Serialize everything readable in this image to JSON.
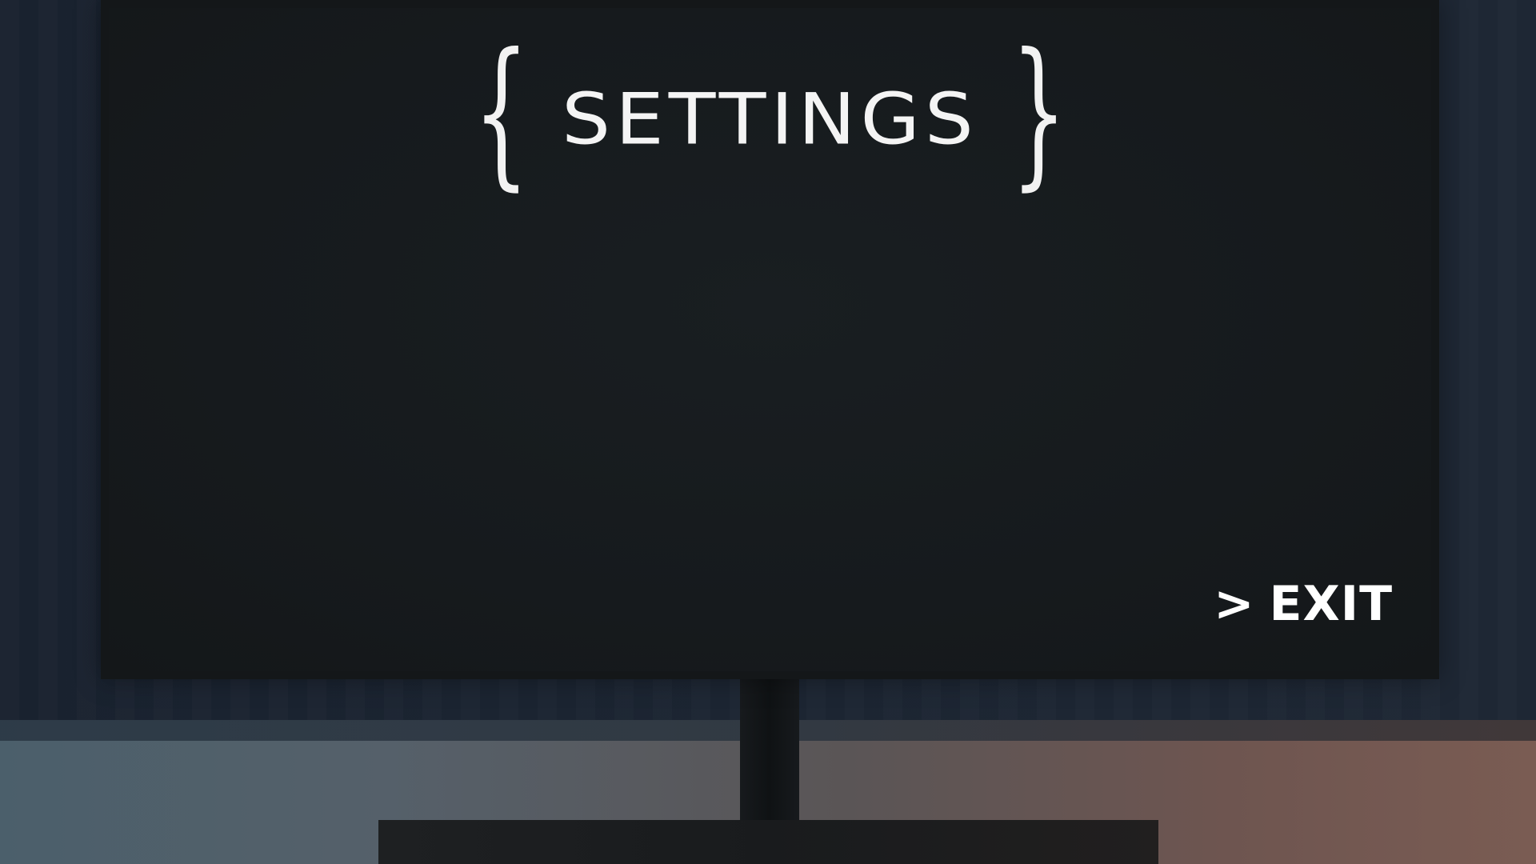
{
  "menu": {
    "title": "SETTINGS",
    "title_brace_left": "{",
    "title_brace_right": "}",
    "exit_arrow": ">",
    "exit_label": "EXIT"
  },
  "colors": {
    "text": "#f4f4f4",
    "screen_bg": "#161a1d",
    "wall_bg": "#1d2633",
    "desk": "#5a5556"
  }
}
